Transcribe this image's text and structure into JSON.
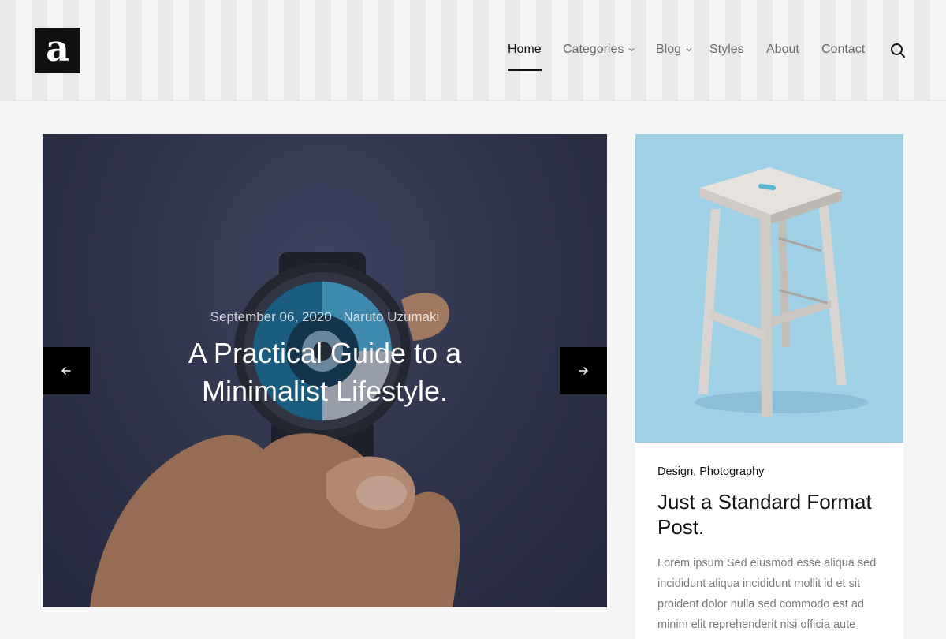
{
  "logo": {
    "letter": "a"
  },
  "nav": {
    "home": "Home",
    "categories": "Categories",
    "blog": "Blog",
    "styles": "Styles",
    "about": "About",
    "contact": "Contact"
  },
  "hero": {
    "date": "September 06, 2020",
    "author": "Naruto Uzumaki",
    "title": "A Practical Guide to a Minimalist Lifestyle."
  },
  "card": {
    "categories": "Design, Photography",
    "title": "Just a Standard Format Post.",
    "excerpt": "Lorem ipsum Sed eiusmod esse aliqua sed incididunt aliqua incididunt mollit id et sit proident dolor nulla sed commodo est ad minim elit reprehenderit nisi officia aute"
  },
  "colors": {
    "accent": "#111111",
    "header_stripe_light": "#f4f4f4",
    "header_stripe_dark": "#e9e9e9",
    "page_bg": "#f5f5f5",
    "card_image_bg": "#9fd0e6"
  },
  "icons": {
    "search": "search-icon",
    "chevron": "chevron-down-icon",
    "prev": "arrow-left-icon",
    "next": "arrow-right-icon"
  }
}
